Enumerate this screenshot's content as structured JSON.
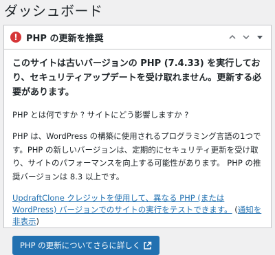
{
  "page": {
    "title": "ダッシュボード"
  },
  "widget": {
    "title": "PHP の更新を推奨",
    "warning_icon_text": "!",
    "lead": "このサイトは古いバージョンの PHP (7.4.33) を実行しており、セキュリティアップデートを受け取れません。更新する必要があります。",
    "question": "PHP とは何ですか ? サイトにどう影響しますか ?",
    "description": "PHP は、WordPress の構築に使用されるプログラミング言語の1つです。PHP の新しいバージョンは、定期的にセキュリティ更新を受け取り、サイトのパフォーマンスを向上する可能性があります。 PHP の推奨バージョンは 8.3 以上です。",
    "test_link": "UpdraftClone クレジットを使用して、異なる PHP (または WordPress) バージョンでのサイトの実行をテストできます。",
    "paren_open": " (",
    "dismiss_link": "通知を非表示",
    "paren_close": ")",
    "button_label": "PHP の更新についてさらに詳しく"
  },
  "icons": {
    "warning": "exclamation-circle-icon",
    "move_up": "chevron-up-icon",
    "move_down": "chevron-down-icon",
    "toggle": "triangle-down-icon",
    "external": "external-link-icon"
  },
  "colors": {
    "accent": "#2271b1",
    "warning": "#d63638",
    "background": "#f0f0f1"
  }
}
